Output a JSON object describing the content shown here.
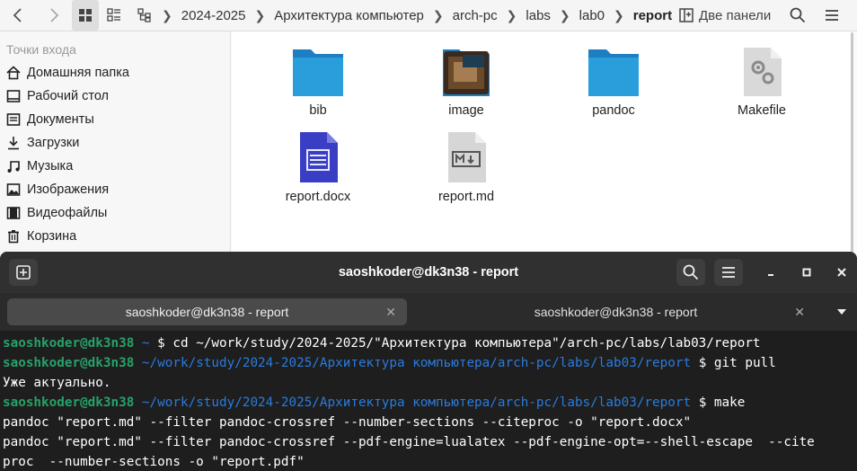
{
  "toolbar": {
    "breadcrumbs": [
      "2024-2025",
      "Архитектура компьютер",
      "arch-pc",
      "labs",
      "lab0",
      "report"
    ],
    "view_label": "Две панели"
  },
  "sidebar": {
    "heading": "Точки входа",
    "items": [
      {
        "label": "Домашняя папка",
        "icon": "home-icon"
      },
      {
        "label": "Рабочий стол",
        "icon": "desktop-icon"
      },
      {
        "label": "Документы",
        "icon": "documents-icon"
      },
      {
        "label": "Загрузки",
        "icon": "downloads-icon"
      },
      {
        "label": "Музыка",
        "icon": "music-icon"
      },
      {
        "label": "Изображения",
        "icon": "pictures-icon"
      },
      {
        "label": "Видеофайлы",
        "icon": "videos-icon"
      },
      {
        "label": "Корзина",
        "icon": "trash-icon"
      }
    ]
  },
  "files": [
    {
      "name": "bib",
      "type": "folder"
    },
    {
      "name": "image",
      "type": "folder-image"
    },
    {
      "name": "pandoc",
      "type": "folder"
    },
    {
      "name": "Makefile",
      "type": "makefile"
    },
    {
      "name": "report.docx",
      "type": "docx"
    },
    {
      "name": "report.md",
      "type": "markdown"
    }
  ],
  "terminal": {
    "title": "saoshkoder@dk3n38 - report",
    "tabs": [
      "saoshkoder@dk3n38 - report",
      "saoshkoder@dk3n38 - report"
    ],
    "lines": [
      {
        "user": "saoshkoder@dk3n38",
        "path": " ~ ",
        "cmd": "$ cd ~/work/study/2024-2025/\"Архитектура компьютера\"/arch-pc/labs/lab03/report"
      },
      {
        "user": "saoshkoder@dk3n38",
        "path": " ~/work/study/2024-2025/Архитектура компьютера/arch-pc/labs/lab03/report ",
        "cmd": "$ git pull"
      },
      {
        "text": "Уже актуально."
      },
      {
        "user": "saoshkoder@dk3n38",
        "path": " ~/work/study/2024-2025/Архитектура компьютера/arch-pc/labs/lab03/report ",
        "cmd": "$ make"
      },
      {
        "text": "pandoc \"report.md\" --filter pandoc-crossref --number-sections --citeproc -o \"report.docx\""
      },
      {
        "text": "pandoc \"report.md\" --filter pandoc-crossref --pdf-engine=lualatex --pdf-engine-opt=--shell-escape  --cite"
      },
      {
        "text": "proc  --number-sections -o \"report.pdf\""
      }
    ]
  },
  "colors": {
    "prompt_user": "#26a269",
    "prompt_path": "#2a7bde",
    "folder": "#2a9ddb"
  }
}
